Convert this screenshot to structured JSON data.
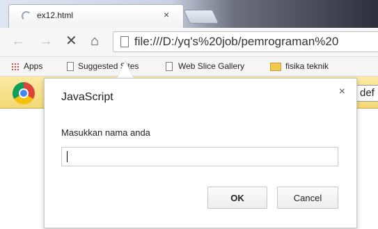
{
  "tab": {
    "title": "ex12.html",
    "close": "×"
  },
  "toolbar": {
    "back": "←",
    "forward": "→",
    "stop": "✕",
    "home": "⌂",
    "url": "file:///D:/yq's%20job/pemrograman%20"
  },
  "bookmarks": {
    "apps": "Apps",
    "suggested": "Suggested Sites",
    "webslice": "Web Slice Gallery",
    "fisika": "fisika teknik"
  },
  "infobar": {
    "button_partial": "def"
  },
  "dialog": {
    "title": "JavaScript",
    "close": "×",
    "message": "Masukkan nama anda",
    "input_value": "",
    "ok_label": "OK",
    "cancel_label": "Cancel"
  }
}
